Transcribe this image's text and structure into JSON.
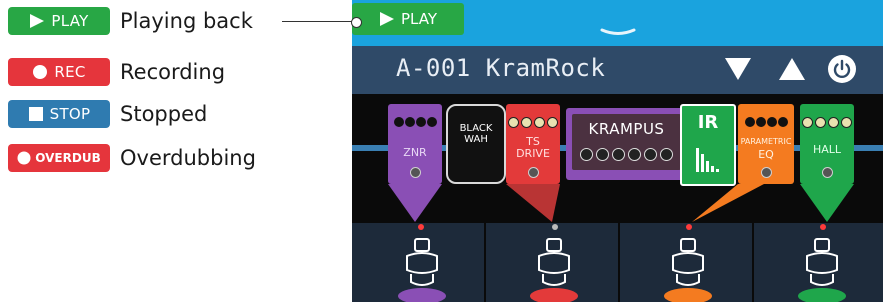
{
  "legend": [
    {
      "badge": "PLAY",
      "label": "Playing back",
      "color": "#28a745",
      "icon": "play-icon"
    },
    {
      "badge": "REC",
      "label": "Recording",
      "color": "#e5353c",
      "icon": "record-icon"
    },
    {
      "badge": "STOP",
      "label": "Stopped",
      "color": "#2f7bb0",
      "icon": "stop-icon"
    },
    {
      "badge": "OVERDUB",
      "label": "Overdubbing",
      "color": "#e5353c",
      "icon": "overdub-icon"
    }
  ],
  "screen": {
    "play_tab": "PLAY",
    "patch_name": "A-001 KramRock",
    "effects": [
      {
        "label": "ZNR",
        "color": "#8a4fb5",
        "icon": "znr-pedal"
      },
      {
        "label_line1": "BLACK",
        "label_line2": "WAH",
        "color": "#111111",
        "icon": "wah-pedal"
      },
      {
        "label_line1": "TS",
        "label_line2": "DRIVE",
        "color": "#e33a3a",
        "icon": "ts-drive-pedal"
      },
      {
        "label": "KRAMPUS",
        "color": "#8a4fb5",
        "icon": "amp-icon"
      },
      {
        "label": "IR",
        "color": "#1fa64b",
        "icon": "ir-icon"
      },
      {
        "label_line1": "PARAMETRIC",
        "label_line2": "EQ",
        "color": "#f47b20",
        "icon": "eq-pedal"
      },
      {
        "label": "HALL",
        "color": "#1fa64b",
        "icon": "hall-reverb-pedal"
      }
    ],
    "footswitch_colors": [
      "#8a4fb5",
      "#e33a3a",
      "#f47b20",
      "#1fa64b"
    ]
  }
}
